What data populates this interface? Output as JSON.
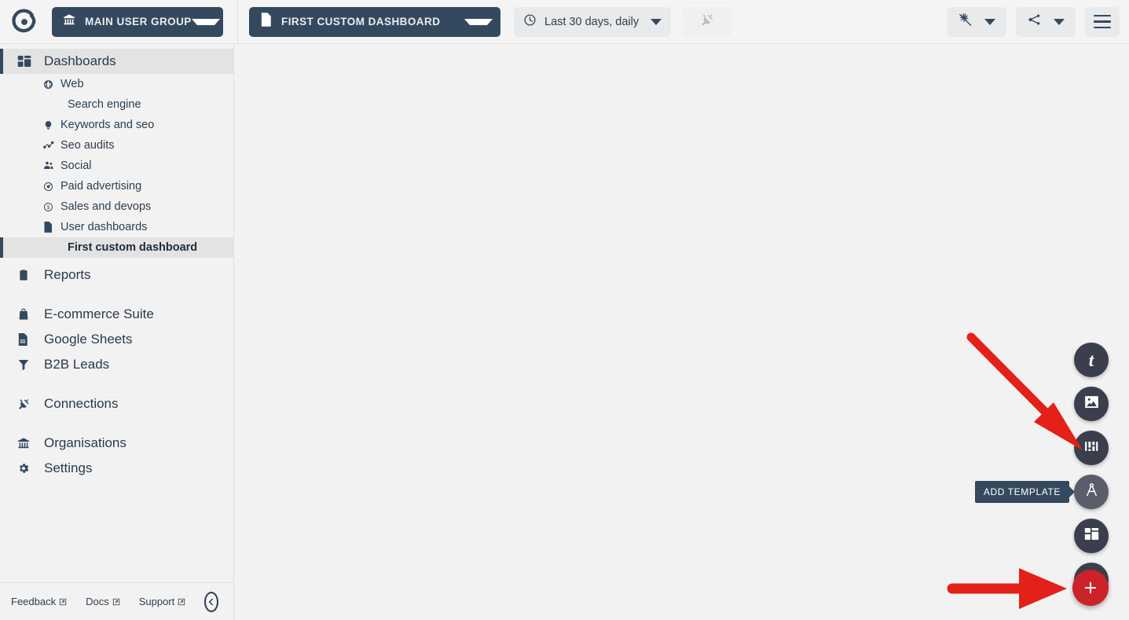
{
  "colors": {
    "brand_dark": "#35495e",
    "accent_red": "#cc2229",
    "fab_dark": "#3b3f4d",
    "sidebar_bg": "#f2f2f2",
    "annotation_arrow": "#e32119"
  },
  "topbar": {
    "logo_icon": "circular-target-logo-icon",
    "user_group": {
      "label": "MAIN USER GROUP",
      "icon": "bank-icon",
      "caret": "chevron-down-icon"
    },
    "dashboard": {
      "label": "FIRST CUSTOM DASHBOARD",
      "icon": "document-icon",
      "caret": "chevron-down-icon"
    },
    "date_range": {
      "label": "Last 30 days, daily",
      "icon": "clock-icon",
      "caret": "chevron-down-icon"
    },
    "plug": {
      "icon": "plug-icon",
      "disabled": true
    },
    "no_ads": {
      "icon": "no-ads-icon",
      "caret": "chevron-down-icon"
    },
    "share": {
      "icon": "share-icon",
      "caret": "chevron-down-icon"
    },
    "menu": {
      "icon": "hamburger-menu-icon"
    }
  },
  "sidebar": {
    "items": [
      {
        "label": "Dashboards",
        "icon": "dashboard-grid-icon",
        "level": "top",
        "selected": true
      },
      {
        "label": "Web",
        "icon": "globe-icon",
        "level": "sub",
        "selected": false
      },
      {
        "label": "Search engine",
        "icon": "",
        "level": "sub-deep",
        "selected": false
      },
      {
        "label": "Keywords and seo",
        "icon": "lightbulb-icon",
        "level": "sub",
        "selected": false
      },
      {
        "label": "Seo audits",
        "icon": "line-chart-icon",
        "level": "sub",
        "selected": false
      },
      {
        "label": "Social",
        "icon": "people-icon",
        "level": "sub",
        "selected": false
      },
      {
        "label": "Paid advertising",
        "icon": "target-refresh-icon",
        "level": "sub",
        "selected": false
      },
      {
        "label": "Sales and devops",
        "icon": "dollar-circle-icon",
        "level": "sub",
        "selected": false
      },
      {
        "label": "User dashboards",
        "icon": "document-icon",
        "level": "sub",
        "selected": false
      },
      {
        "label": "First custom dashboard",
        "icon": "",
        "level": "sub-deep",
        "selected": true
      },
      {
        "label": "Reports",
        "icon": "clipboard-icon",
        "level": "top",
        "selected": false
      },
      {
        "label": "E-commerce Suite",
        "icon": "bag-icon",
        "level": "top",
        "selected": false
      },
      {
        "label": "Google Sheets",
        "icon": "sheets-icon",
        "level": "top",
        "selected": false
      },
      {
        "label": "B2B Leads",
        "icon": "funnel-icon",
        "level": "top",
        "selected": false
      },
      {
        "label": "Connections",
        "icon": "plug-icon",
        "level": "top",
        "selected": false
      },
      {
        "label": "Organisations",
        "icon": "bank-icon",
        "level": "top",
        "selected": false
      },
      {
        "label": "Settings",
        "icon": "gear-icon",
        "level": "top",
        "selected": false
      }
    ],
    "footer": {
      "links": [
        {
          "label": "Feedback",
          "icon": "external-link-icon"
        },
        {
          "label": "Docs",
          "icon": "external-link-icon"
        },
        {
          "label": "Support",
          "icon": "external-link-icon"
        }
      ],
      "collapse": {
        "icon": "arrow-left-circle-icon"
      }
    }
  },
  "main": {
    "fabs": [
      {
        "name": "add-text-widget",
        "icon": "text-t-icon",
        "glyph": "t",
        "highlight": false
      },
      {
        "name": "add-image-widget",
        "icon": "image-icon",
        "glyph": "",
        "highlight": false
      },
      {
        "name": "add-chart-widget",
        "icon": "bar-chart-icon",
        "glyph": "",
        "highlight": false
      },
      {
        "name": "add-template",
        "icon": "compass-draft-icon",
        "glyph": "",
        "highlight": true
      },
      {
        "name": "add-layout-widget",
        "icon": "dashboard-grid-icon",
        "glyph": "",
        "highlight": false
      },
      {
        "name": "add-app-widget",
        "icon": "app-store-icon",
        "glyph": "",
        "highlight": false
      }
    ],
    "fab_main": {
      "name": "add-widget-button",
      "icon": "plus-icon"
    },
    "tooltip": {
      "text": "ADD TEMPLATE"
    }
  }
}
